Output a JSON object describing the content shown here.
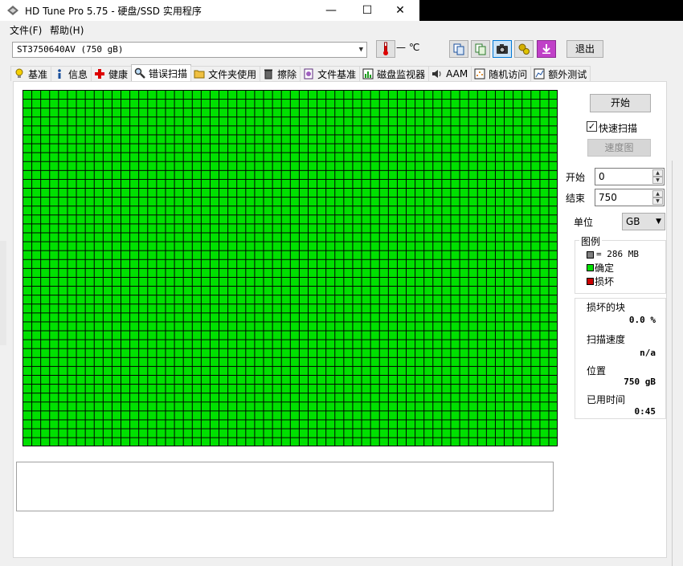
{
  "window": {
    "title": "HD Tune Pro 5.75 - 硬盘/SSD 实用程序",
    "minimize": "—",
    "maximize": "☐",
    "close": "✕"
  },
  "menu": {
    "file": "文件(F)",
    "help": "帮助(H)"
  },
  "toolbar": {
    "drive": "ST3750640AV (750 gB)",
    "temperature": "— ℃",
    "exit_label": "退出",
    "icons": [
      "copy-icon",
      "copy-all-icon",
      "screenshot-icon",
      "options-icon",
      "save-icon"
    ]
  },
  "tabs": [
    {
      "label": "基准",
      "icon": "lightbulb-icon"
    },
    {
      "label": "信息",
      "icon": "info-icon"
    },
    {
      "label": "健康",
      "icon": "health-cross-icon"
    },
    {
      "label": "错误扫描",
      "icon": "magnifier-icon",
      "active": true
    },
    {
      "label": "文件夹使用",
      "icon": "folder-icon"
    },
    {
      "label": "擦除",
      "icon": "trash-icon"
    },
    {
      "label": "文件基准",
      "icon": "file-benchmark-icon"
    },
    {
      "label": "磁盘监视器",
      "icon": "monitor-icon"
    },
    {
      "label": "AAM",
      "icon": "speaker-icon"
    },
    {
      "label": "随机访问",
      "icon": "random-access-icon"
    },
    {
      "label": "额外测试",
      "icon": "extra-tests-icon"
    }
  ],
  "scan": {
    "start_button": "开始",
    "quick_scan_label": "快速扫描",
    "quick_scan_checked": true,
    "speed_map_button": "速度图",
    "start_label": "开始",
    "start_value": "0",
    "end_label": "结束",
    "end_value": "750",
    "unit_label": "单位",
    "unit_value": "GB",
    "block_status": "ok",
    "colors": {
      "ok": "#00e000",
      "damaged": "#cc0000",
      "block": "#808080"
    }
  },
  "legend": {
    "title": "图例",
    "block_size": "= 286 MB",
    "ok_label": "确定",
    "damaged_label": "损坏"
  },
  "stats": {
    "damaged_blocks_label": "损坏的块",
    "damaged_blocks_value": "0.0 %",
    "scan_speed_label": "扫描速度",
    "scan_speed_value": "n/a",
    "position_label": "位置",
    "position_value": "750 gB",
    "elapsed_label": "已用时间",
    "elapsed_value": "0:45"
  }
}
